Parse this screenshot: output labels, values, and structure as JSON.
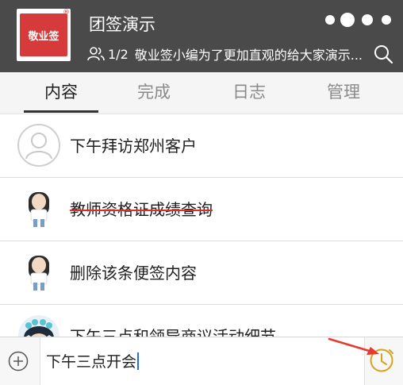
{
  "header": {
    "logo_text": "敬业签",
    "title": "团签演示",
    "member_count": "1/2",
    "marquee": "敬业签小编为了更加直观的给大家演示..."
  },
  "tabs": [
    {
      "label": "内容",
      "active": true
    },
    {
      "label": "完成",
      "active": false
    },
    {
      "label": "日志",
      "active": false
    },
    {
      "label": "管理",
      "active": false
    }
  ],
  "items": [
    {
      "text": "下午拜访郑州客户",
      "completed": false,
      "avatar": "default-avatar"
    },
    {
      "text": "教师资格证成绩查询",
      "completed": true,
      "avatar": "girl-avatar"
    },
    {
      "text": "删除该条便签内容",
      "completed": false,
      "avatar": "girl-avatar"
    },
    {
      "text": "下午三点和领导商议活动细节",
      "completed": false,
      "avatar": "character-avatar"
    }
  ],
  "input": {
    "value": "下午三点开会"
  },
  "icons": {
    "add": "plus-circle-icon",
    "clock": "clock-icon",
    "search": "search-icon",
    "members": "members-icon",
    "more": "more-dots-icon"
  },
  "colors": {
    "header_bg": "#4a4a4a",
    "logo_red": "#d63a3a",
    "accent_clock": "#d9a21b",
    "strike": "#d9302a",
    "arrow": "#e8392f"
  }
}
